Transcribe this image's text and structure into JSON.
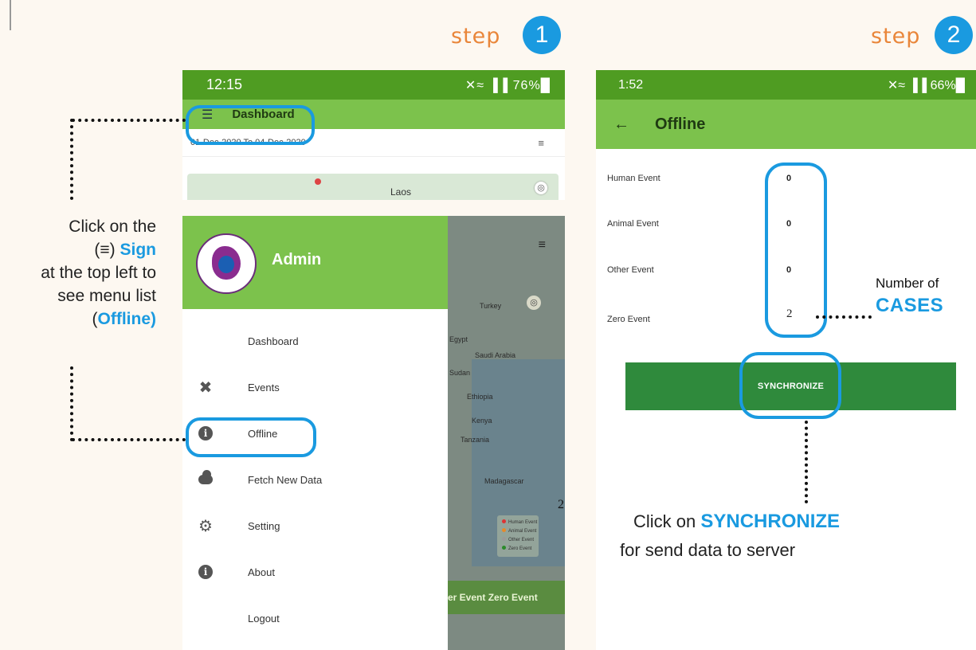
{
  "steps": {
    "step1": {
      "word": "step",
      "number": "1"
    },
    "step2": {
      "word": "step",
      "number": "2"
    }
  },
  "phone1": {
    "status": {
      "time": "12:15",
      "icons": "✕≈ ▐▐ 76%█",
      "battery": "76%"
    },
    "appbar": {
      "menu_icon": "hamburger-icon",
      "title": "Dashboard"
    },
    "date_range": "01-Dec-2020 To 04-Dec-2020",
    "map": {
      "label": "Laos"
    },
    "drawer": {
      "user": "Admin",
      "items": [
        {
          "label": "Dashboard",
          "icon": "dashboard-icon"
        },
        {
          "label": "Events",
          "icon": "events-icon"
        },
        {
          "label": "Offline",
          "icon": "info-icon"
        },
        {
          "label": "Fetch New Data",
          "icon": "cloud-icon"
        },
        {
          "label": "Setting",
          "icon": "gear-icon"
        },
        {
          "label": "About",
          "icon": "info-icon"
        },
        {
          "label": "Logout",
          "icon": "dashboard-icon"
        }
      ]
    },
    "map_bg": {
      "labels": [
        "Turkey",
        "Egypt",
        "Saudi Arabia",
        "Sudan",
        "Ethiopia",
        "Kenya",
        "Tanzania",
        "Madagascar"
      ],
      "legend": [
        "Human Event",
        "Animal Event",
        "Other Event",
        "Zero Event"
      ],
      "bottom_bar": "er Event  Zero Event"
    }
  },
  "phone2": {
    "status": {
      "time": "1:52",
      "icons": "✕≈ ▐▐ 66%█",
      "battery": "66%"
    },
    "appbar": {
      "title": "Offline"
    },
    "events": [
      {
        "label": "Human Event",
        "value": "0"
      },
      {
        "label": "Animal Event",
        "value": "0"
      },
      {
        "label": "Other Event",
        "value": "0"
      },
      {
        "label": "Zero Event",
        "value": "2"
      }
    ],
    "sync_button": "SYNCHRONIZE"
  },
  "annotations": {
    "left": {
      "line1": "Click on the",
      "open": "(",
      "close": ")",
      "sign": "Sign",
      "line3": "at the top left to",
      "line4": "see menu list",
      "offline": "Offline"
    },
    "cases": {
      "line1": "Number of",
      "line2": "CASES"
    },
    "sync": {
      "prefix": "Click on ",
      "keyword": "SYNCHRONIZE",
      "line2": "for send data to server"
    },
    "page_marker": "2"
  },
  "colors": {
    "accent_blue": "#1a9ae0",
    "step_orange": "#e9863a",
    "status_green": "#4f9c22",
    "appbar_green": "#7cc24c",
    "button_green": "#2f8a3c"
  }
}
